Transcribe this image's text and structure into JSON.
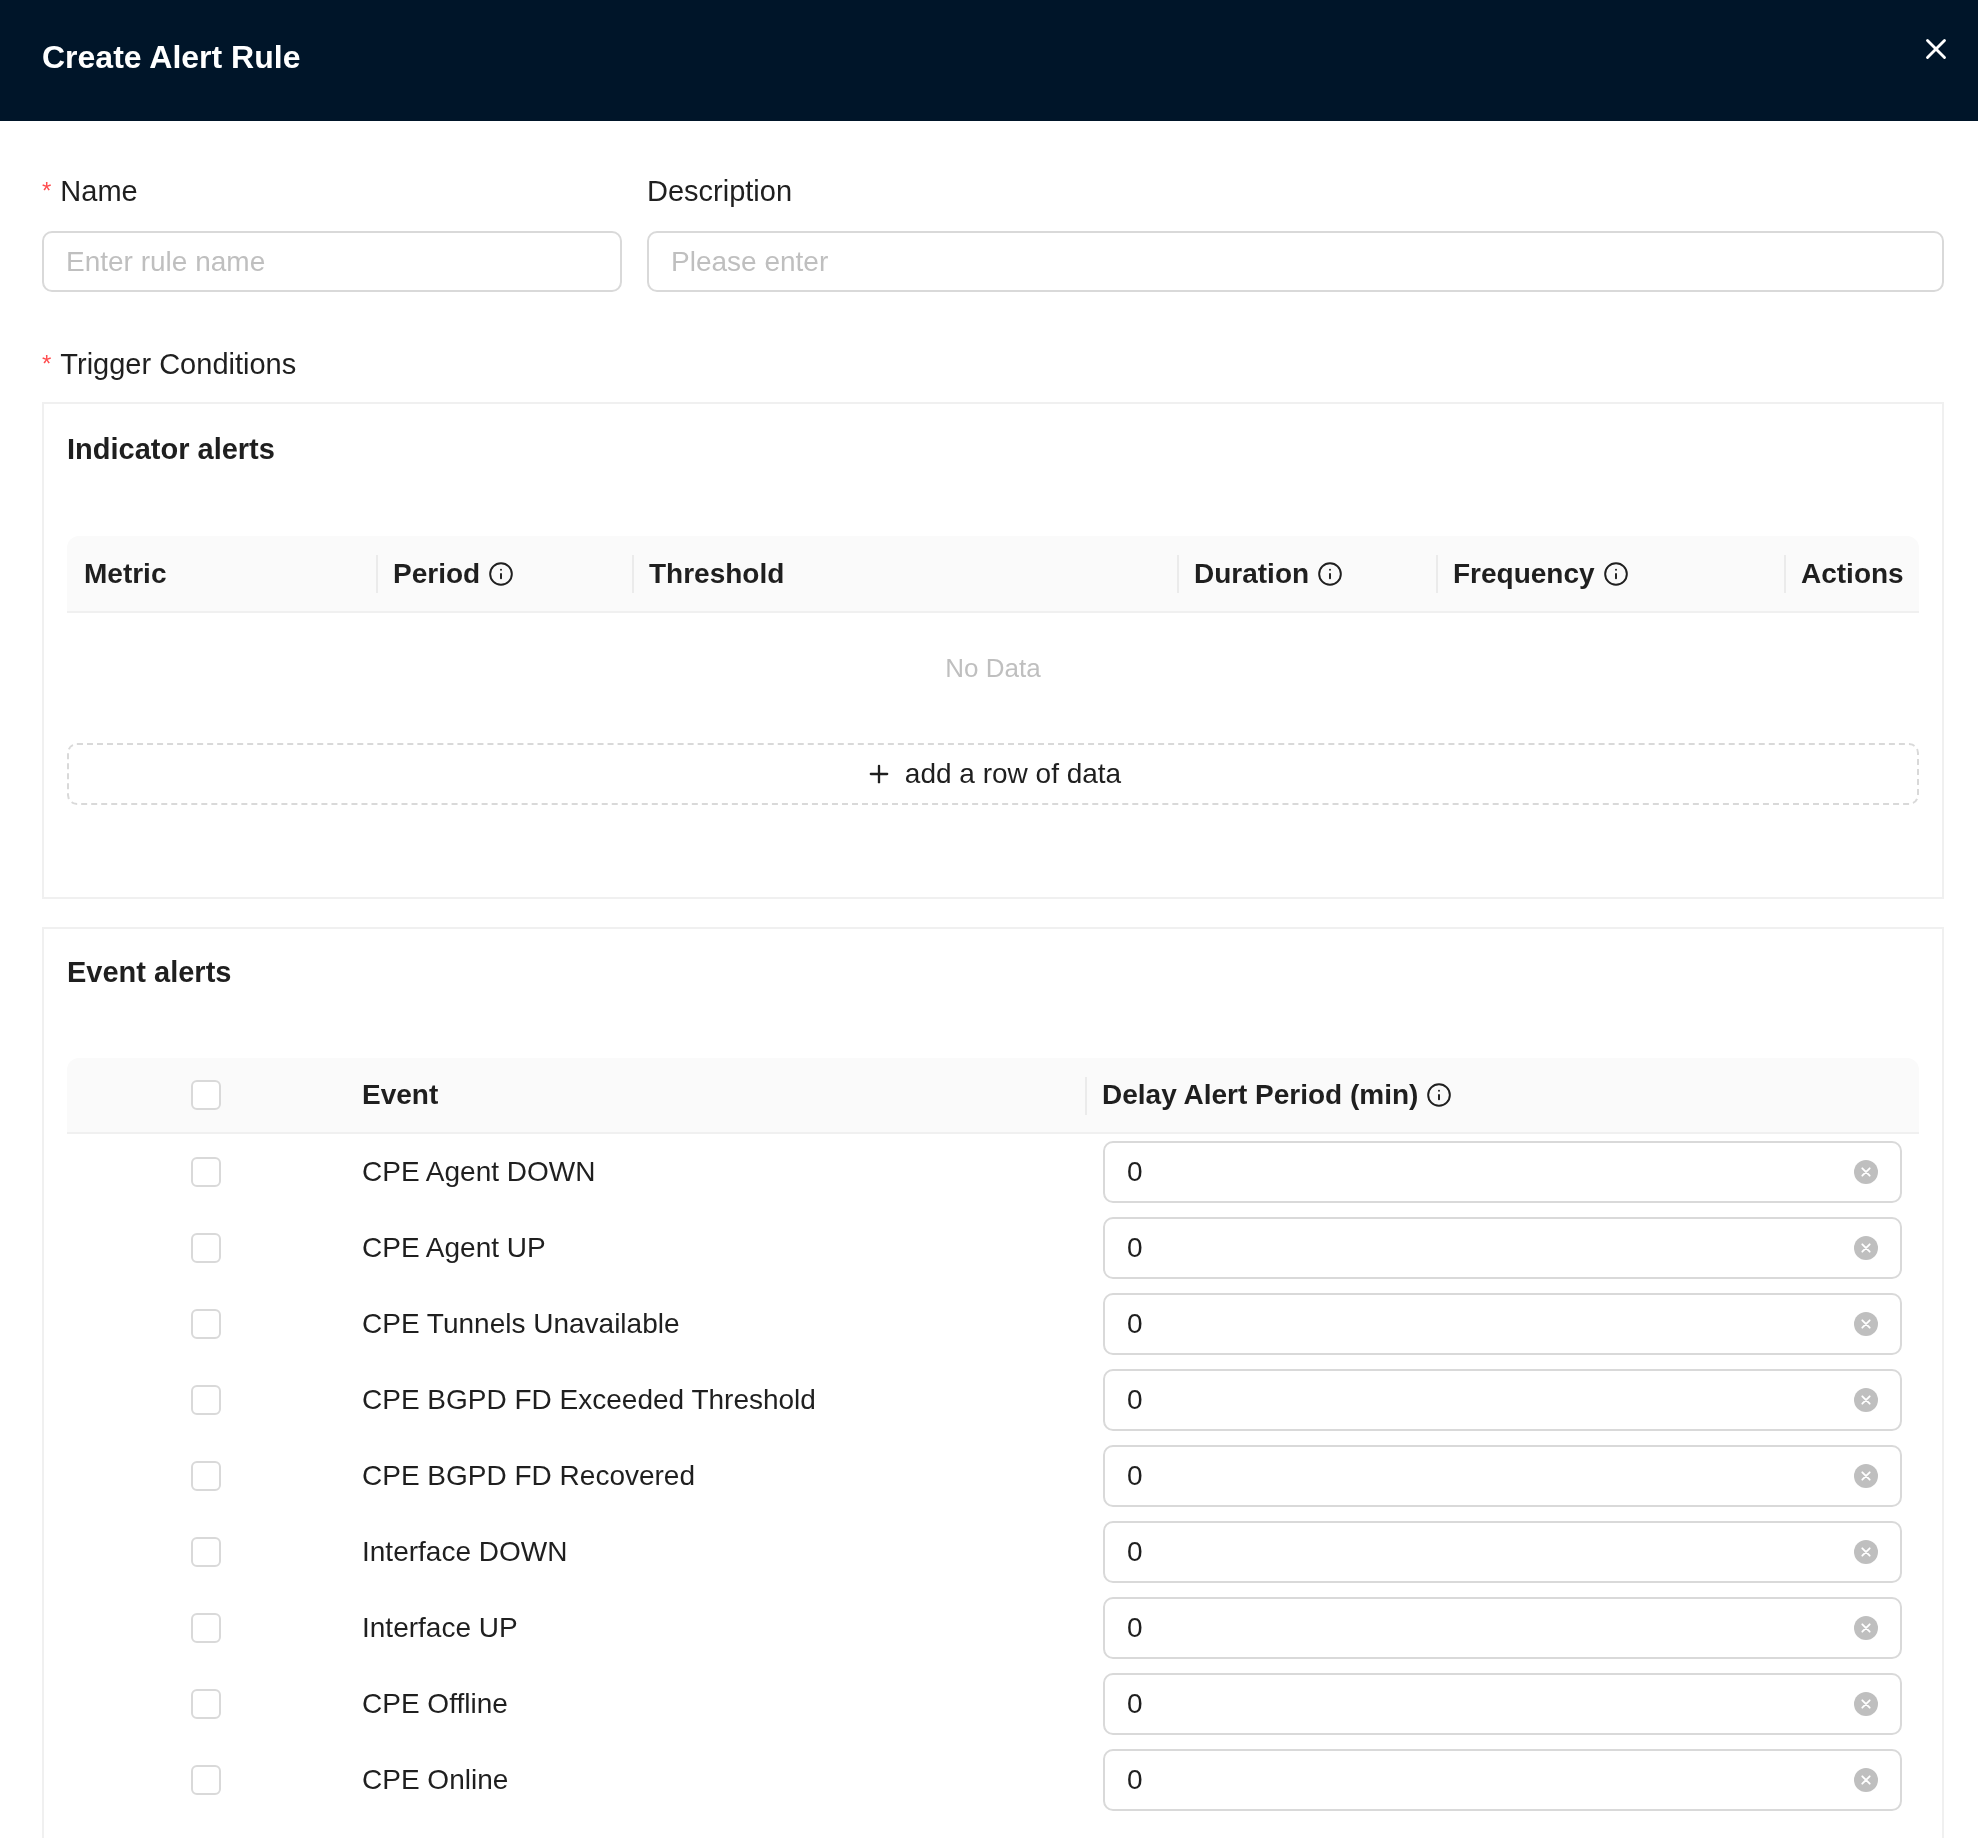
{
  "dialog": {
    "title": "Create Alert Rule"
  },
  "fields": [
    {
      "label": "Name",
      "required_mark": "*",
      "placeholder": "Enter rule name"
    },
    {
      "label": "Description",
      "placeholder": "Please enter"
    }
  ],
  "trigger_conditions": {
    "label": "Trigger Conditions",
    "required_mark": "*"
  },
  "indicator_alerts": {
    "title": "Indicator alerts",
    "columns": [
      {
        "label": "Metric",
        "info": false
      },
      {
        "label": "Period",
        "info": true
      },
      {
        "label": "Threshold",
        "info": false
      },
      {
        "label": "Duration",
        "info": true
      },
      {
        "label": "Frequency",
        "info": true
      },
      {
        "label": "Actions",
        "info": false
      }
    ],
    "empty_text": "No Data",
    "add_button": "add a row of data"
  },
  "event_alerts": {
    "title": "Event alerts",
    "select_all": {
      "checked": false
    },
    "columns": [
      {
        "label": "Event",
        "info": false
      },
      {
        "label": "Delay Alert Period (min)",
        "info": true
      }
    ],
    "rows": [
      {
        "event": "CPE Agent DOWN",
        "checked": false,
        "delay": "0"
      },
      {
        "event": "CPE Agent UP",
        "checked": false,
        "delay": "0"
      },
      {
        "event": "CPE Tunnels Unavailable",
        "checked": false,
        "delay": "0"
      },
      {
        "event": "CPE BGPD FD Exceeded Threshold",
        "checked": false,
        "delay": "0"
      },
      {
        "event": "CPE BGPD FD Recovered",
        "checked": false,
        "delay": "0"
      },
      {
        "event": "Interface DOWN",
        "checked": false,
        "delay": "0"
      },
      {
        "event": "Interface UP",
        "checked": false,
        "delay": "0"
      },
      {
        "event": "CPE Offline",
        "checked": false,
        "delay": "0"
      },
      {
        "event": "CPE Online",
        "checked": false,
        "delay": "0"
      }
    ]
  }
}
